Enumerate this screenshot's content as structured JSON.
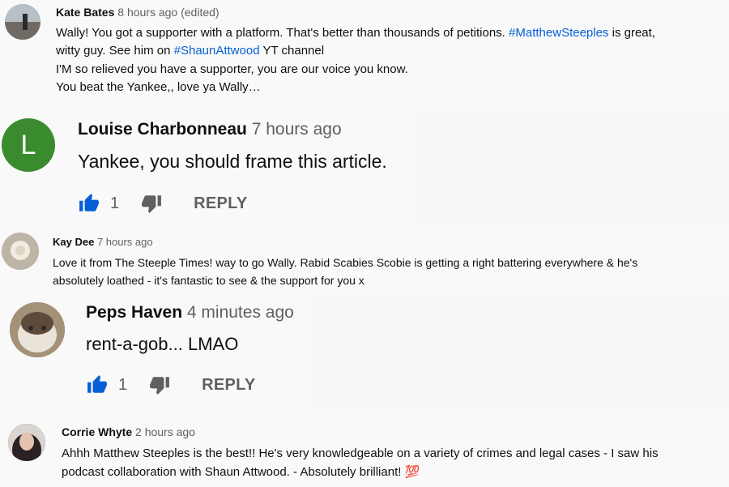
{
  "comments": [
    {
      "author": "Kate Bates",
      "time": "8 hours ago (edited)",
      "lines": [
        [
          "Wally! You got a supporter with a platform. That's better than thousands of petitions. ",
          "#MatthewSteeples",
          " is great,"
        ],
        [
          "witty guy. See him on ",
          "#ShaunAttwood",
          " YT channel"
        ],
        [
          "I'M so relieved you have a supporter, you are our voice you know."
        ],
        [
          "You beat the Yankee,, love ya Wally…"
        ]
      ]
    },
    {
      "author": "Louise Charbonneau",
      "time": "7 hours ago",
      "avatar_letter": "L",
      "text": "Yankee, you should frame this article.",
      "likes": "1",
      "reply_label": "REPLY"
    },
    {
      "author": "Kay Dee",
      "time": "7 hours ago",
      "lines": [
        "Love it from The Steeple Times! way to go Wally. Rabid Scabies Scobie is getting a right battering everywhere & he's",
        "absolutely loathed - it's fantastic to see & the support for you x"
      ]
    },
    {
      "author": "Peps Haven",
      "time": "4 minutes ago",
      "text": "rent-a-gob... LMAO",
      "likes": "1",
      "reply_label": "REPLY"
    },
    {
      "author": "Corrie Whyte",
      "time": "2 hours ago",
      "lines": [
        "Ahhh Matthew Steeples is the best!! He's very knowledgeable on a variety of crimes and legal cases - I saw his",
        "podcast collaboration with Shaun Attwood. - Absolutely brilliant! 💯"
      ]
    }
  ],
  "colors": {
    "link": "#065fd4",
    "like_blue": "#065fd4",
    "avatar_green": "#3a8a2e"
  }
}
